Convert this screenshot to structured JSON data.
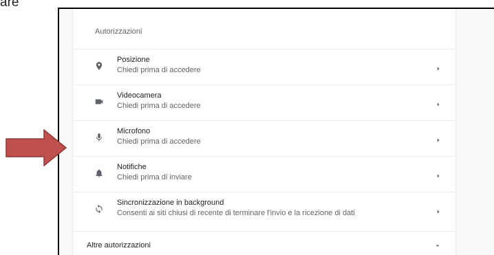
{
  "page_label": "are",
  "permissions": {
    "title": "Autorizzazioni",
    "items": [
      {
        "label": "Posizione",
        "sub": "Chiedi prima di accedere",
        "icon": "location-pin-icon"
      },
      {
        "label": "Videocamera",
        "sub": "Chiedi prima di accedere",
        "icon": "videocam-icon"
      },
      {
        "label": "Microfono",
        "sub": "Chiedi prima di accedere",
        "icon": "mic-icon"
      },
      {
        "label": "Notifiche",
        "sub": "Chiedi prima di inviare",
        "icon": "bell-icon"
      },
      {
        "label": "Sincronizzazione in background",
        "sub": "Consenti ai siti chiusi di recente di terminare l'invio e la ricezione di dati",
        "icon": "sync-icon"
      }
    ],
    "more": {
      "label": "Altre autorizzazioni",
      "icon": "chevron-down-icon"
    }
  },
  "annotation": {
    "icon": "red-arrow-icon",
    "color": "#c0504d"
  }
}
